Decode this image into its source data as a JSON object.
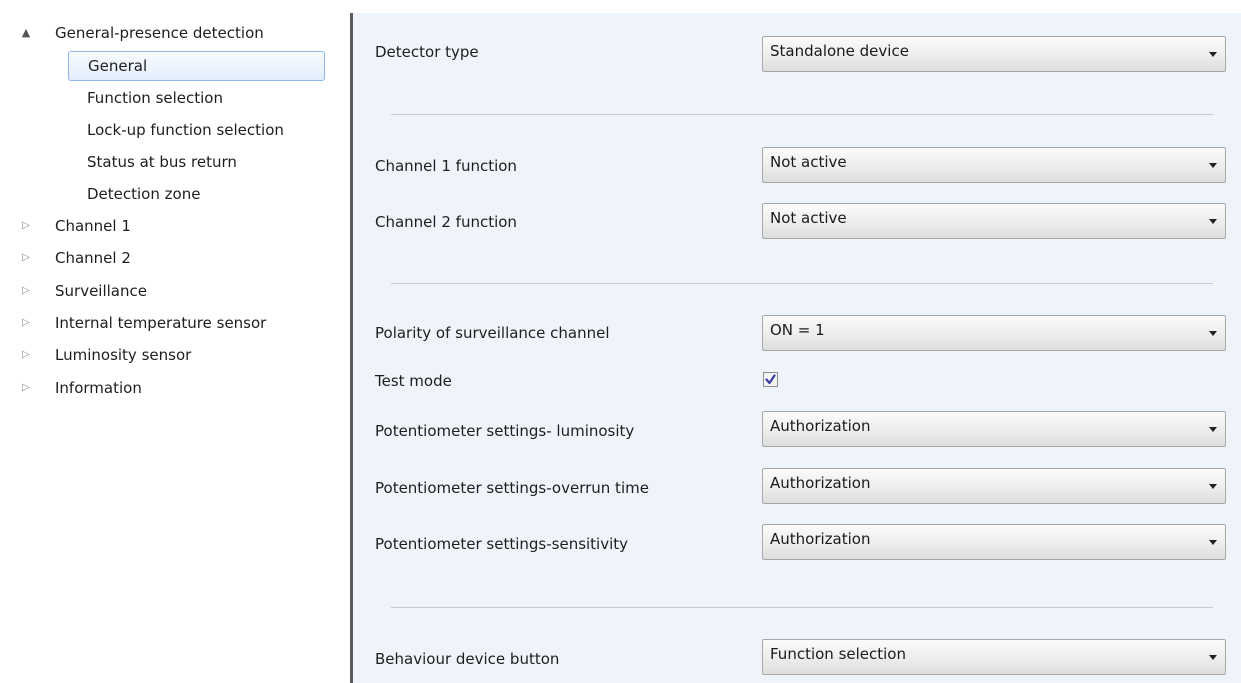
{
  "tree": {
    "items": [
      {
        "label": "General-presence detection",
        "expanded": true
      },
      {
        "label": "General",
        "selected": true
      },
      {
        "label": "Function selection"
      },
      {
        "label": "Lock-up function selection"
      },
      {
        "label": "Status at bus return"
      },
      {
        "label": "Detection zone"
      },
      {
        "label": "Channel 1",
        "expanded": false
      },
      {
        "label": "Channel 2",
        "expanded": false
      },
      {
        "label": "Surveillance",
        "expanded": false
      },
      {
        "label": "Internal temperature sensor",
        "expanded": false
      },
      {
        "label": "Luminosity sensor",
        "expanded": false
      },
      {
        "label": "Information",
        "expanded": false
      }
    ],
    "expanded_icon": "▲",
    "collapsed_icon": "▷"
  },
  "panel": {
    "detector_type": {
      "label": "Detector type",
      "value": "Standalone device"
    },
    "channel1_function": {
      "label": "Channel 1 function",
      "value": "Not active"
    },
    "channel2_function": {
      "label": "Channel 2 function",
      "value": "Not active"
    },
    "polarity": {
      "label": "Polarity of surveillance channel",
      "value": "ON = 1"
    },
    "test_mode": {
      "label": "Test mode",
      "checked": true
    },
    "pot_luminosity": {
      "label": "Potentiometer settings- luminosity",
      "value": "Authorization"
    },
    "pot_overrun": {
      "label": "Potentiometer settings-overrun time",
      "value": "Authorization"
    },
    "pot_sensitivity": {
      "label": "Potentiometer settings-sensitivity",
      "value": "Authorization"
    },
    "device_button": {
      "label": "Behaviour device button",
      "value": "Function selection"
    }
  },
  "colors": {
    "panel_bg": "#eef4fa",
    "selection_border": "#8fb7e6",
    "splitter": "#5a5a5a",
    "check": "#3c3ca8"
  }
}
